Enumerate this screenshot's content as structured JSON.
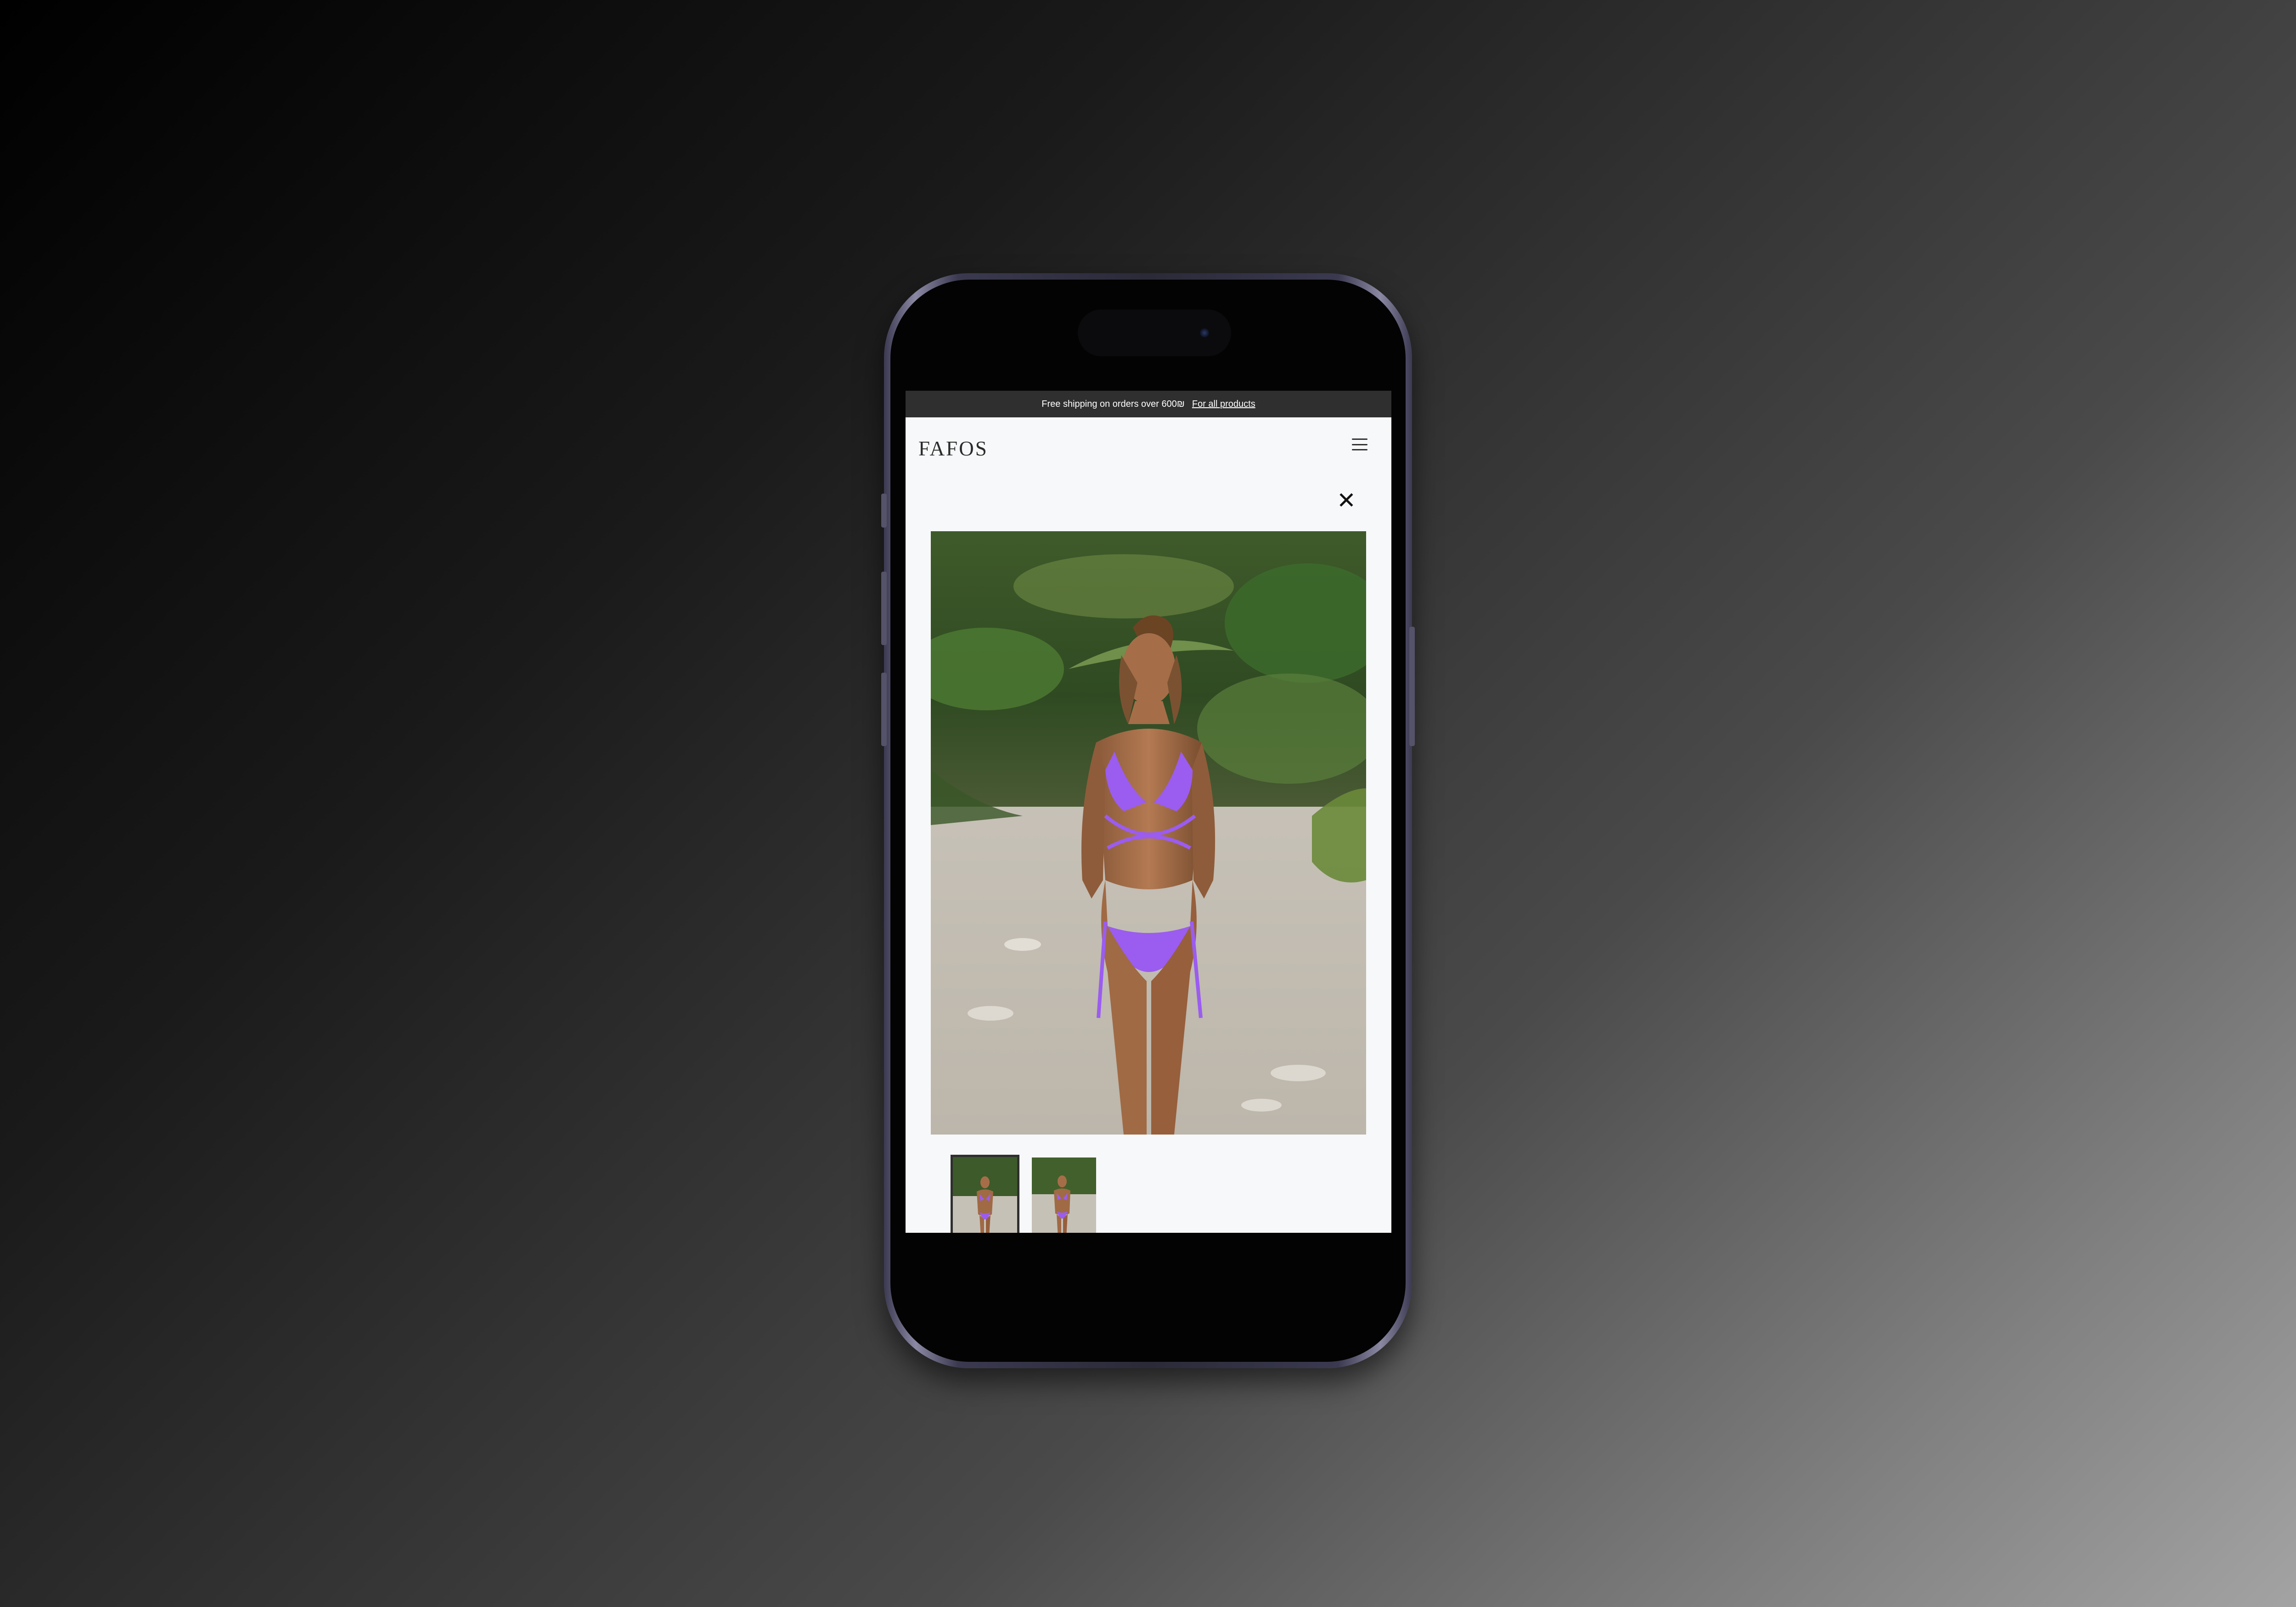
{
  "announcement": {
    "text": "Free shipping on orders over 600₪",
    "link_text": "For all products"
  },
  "header": {
    "logo": "FAFOS",
    "menu_icon": "hamburger-menu-icon"
  },
  "gallery": {
    "close_icon": "close-icon",
    "close_glyph": "✕",
    "main_image": "product-photo-purple-bikini",
    "thumbnails": [
      "thumbnail-front-view",
      "thumbnail-alternate-view"
    ],
    "selected_thumbnail_index": 0
  },
  "colors": {
    "announcement_bg": "#2f2f2f",
    "page_bg": "#f7f8f9",
    "product_accent": "#9b5cf0",
    "phone_frame": "#3a3950"
  }
}
